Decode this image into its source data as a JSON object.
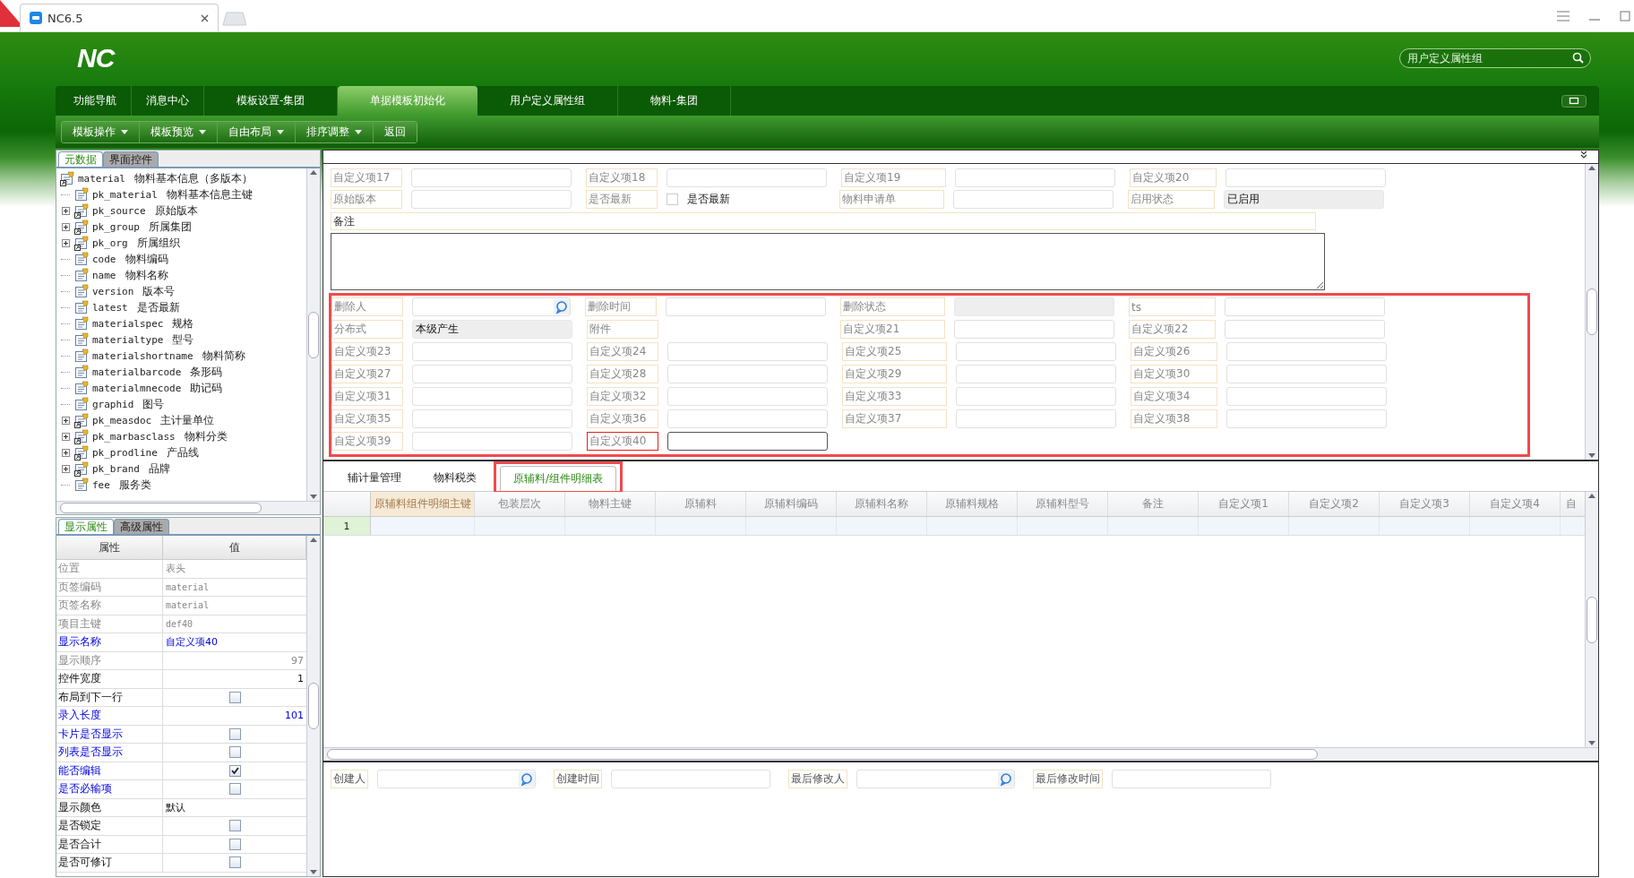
{
  "browser": {
    "tab_title": "NC6.5"
  },
  "header": {
    "logo": "NC",
    "search": {
      "placeholder": "用户定义属性组"
    }
  },
  "nav_tabs": [
    {
      "label": "功能导航",
      "selected": false
    },
    {
      "label": "消息中心",
      "selected": false
    },
    {
      "label": "模板设置-集团",
      "selected": false
    },
    {
      "label": "单据模板初始化",
      "selected": true
    },
    {
      "label": "用户定义属性组",
      "selected": false
    },
    {
      "label": "物料-集团",
      "selected": false
    }
  ],
  "toolbar": [
    {
      "label": "模板操作",
      "kind": "menu"
    },
    {
      "label": "模板预览",
      "kind": "menu"
    },
    {
      "label": "自由布局",
      "kind": "menu"
    },
    {
      "label": "排序调整",
      "kind": "menu"
    },
    {
      "label": "返回",
      "kind": "button"
    }
  ],
  "metadata_panel": {
    "tabs": [
      {
        "label": "元数据",
        "selected": true
      },
      {
        "label": "界面控件",
        "selected": false
      }
    ],
    "tree": {
      "code": "material",
      "label": "物料基本信息（多版本）",
      "children": [
        {
          "code": "pk_material",
          "label": "物料基本信息主键",
          "kind": "field"
        },
        {
          "code": "pk_source",
          "label": "原始版本",
          "kind": "ref"
        },
        {
          "code": "pk_group",
          "label": "所属集团",
          "kind": "ref"
        },
        {
          "code": "pk_org",
          "label": "所属组织",
          "kind": "ref"
        },
        {
          "code": "code",
          "label": "物料编码",
          "kind": "field"
        },
        {
          "code": "name",
          "label": "物料名称",
          "kind": "field"
        },
        {
          "code": "version",
          "label": "版本号",
          "kind": "field"
        },
        {
          "code": "latest",
          "label": "是否最新",
          "kind": "field"
        },
        {
          "code": "materialspec",
          "label": "规格",
          "kind": "field"
        },
        {
          "code": "materialtype",
          "label": "型号",
          "kind": "field"
        },
        {
          "code": "materialshortname",
          "label": "物料简称",
          "kind": "field"
        },
        {
          "code": "materialbarcode",
          "label": "条形码",
          "kind": "field"
        },
        {
          "code": "materialmnecode",
          "label": "助记码",
          "kind": "field"
        },
        {
          "code": "graphid",
          "label": "图号",
          "kind": "field"
        },
        {
          "code": "pk_measdoc",
          "label": "主计量单位",
          "kind": "ref"
        },
        {
          "code": "pk_marbasclass",
          "label": "物料分类",
          "kind": "ref"
        },
        {
          "code": "pk_prodline",
          "label": "产品线",
          "kind": "ref"
        },
        {
          "code": "pk_brand",
          "label": "品牌",
          "kind": "ref"
        },
        {
          "code": "fee",
          "label": "服务类",
          "kind": "field"
        }
      ]
    }
  },
  "properties_panel": {
    "tabs": [
      {
        "label": "显示属性",
        "selected": true
      },
      {
        "label": "高级属性",
        "selected": false
      }
    ],
    "columns": [
      "属性",
      "值"
    ],
    "rows": [
      {
        "name": "位置",
        "kind": "text",
        "value": "表头",
        "disabled": true,
        "highlighted": false
      },
      {
        "name": "页签编码",
        "kind": "code",
        "value": "material",
        "disabled": true,
        "highlighted": false
      },
      {
        "name": "页签名称",
        "kind": "code",
        "value": "material",
        "disabled": true,
        "highlighted": false
      },
      {
        "name": "项目主键",
        "kind": "code",
        "value": "def40",
        "disabled": true,
        "highlighted": false
      },
      {
        "name": "显示名称",
        "kind": "text",
        "value": "自定义项40",
        "disabled": false,
        "highlighted": true
      },
      {
        "name": "显示顺序",
        "kind": "number",
        "value": "97",
        "disabled": true,
        "highlighted": false
      },
      {
        "name": "控件宽度",
        "kind": "number",
        "value": "1",
        "disabled": false,
        "highlighted": false
      },
      {
        "name": "布局到下一行",
        "kind": "check",
        "checked": false,
        "disabled": false,
        "highlighted": false
      },
      {
        "name": "录入长度",
        "kind": "number",
        "value": "101",
        "disabled": false,
        "highlighted": true
      },
      {
        "name": "卡片是否显示",
        "kind": "check",
        "checked": false,
        "disabled": false,
        "highlighted": true
      },
      {
        "name": "列表是否显示",
        "kind": "check",
        "checked": false,
        "disabled": false,
        "highlighted": true
      },
      {
        "name": "能否编辑",
        "kind": "check",
        "checked": true,
        "disabled": false,
        "highlighted": true
      },
      {
        "name": "是否必输项",
        "kind": "check",
        "checked": false,
        "disabled": false,
        "highlighted": true
      },
      {
        "name": "显示颜色",
        "kind": "text",
        "value": "默认",
        "disabled": false,
        "highlighted": false
      },
      {
        "name": "是否锁定",
        "kind": "check",
        "checked": false,
        "disabled": false,
        "highlighted": false
      },
      {
        "name": "是否合计",
        "kind": "check",
        "checked": false,
        "disabled": false,
        "highlighted": false
      },
      {
        "name": "是否可修订",
        "kind": "check",
        "checked": false,
        "disabled": false,
        "highlighted": false
      }
    ]
  },
  "form": {
    "top_rows": [
      [
        {
          "label": "自定义项17",
          "kind": "text"
        },
        {
          "label": "自定义项18",
          "kind": "text"
        },
        {
          "label": "自定义项19",
          "kind": "text"
        },
        {
          "label": "自定义项20",
          "kind": "text"
        }
      ],
      [
        {
          "label": "原始版本",
          "kind": "text"
        },
        {
          "label": "是否最新",
          "kind": "check",
          "checked": false,
          "value": "是否最新"
        },
        {
          "label": "物料申请单",
          "kind": "text"
        },
        {
          "label": "启用状态",
          "kind": "readonly",
          "value": "已启用"
        }
      ]
    ],
    "remark": {
      "label": "备注"
    },
    "annotated_group": {
      "highlighted": true,
      "rows": [
        [
          {
            "label": "删除人",
            "kind": "ref",
            "highlighted": false
          },
          {
            "label": "删除时间",
            "kind": "text",
            "highlighted": false
          },
          {
            "label": "删除状态",
            "kind": "readonly",
            "highlighted": false
          },
          {
            "label": "ts",
            "kind": "text",
            "highlighted": false
          }
        ],
        [
          {
            "label": "分布式",
            "kind": "readonly",
            "value": "本级产生",
            "highlighted": false
          },
          {
            "label": "附件",
            "kind": "none",
            "highlighted": false
          },
          {
            "label": "自定义项21",
            "kind": "text",
            "highlighted": false
          },
          {
            "label": "自定义项22",
            "kind": "text",
            "highlighted": false
          }
        ],
        [
          {
            "label": "自定义项23",
            "kind": "text",
            "highlighted": false
          },
          {
            "label": "自定义项24",
            "kind": "text",
            "highlighted": false
          },
          {
            "label": "自定义项25",
            "kind": "text",
            "highlighted": false
          },
          {
            "label": "自定义项26",
            "kind": "text",
            "highlighted": false
          }
        ],
        [
          {
            "label": "自定义项27",
            "kind": "text",
            "highlighted": false
          },
          {
            "label": "自定义项28",
            "kind": "text",
            "highlighted": false
          },
          {
            "label": "自定义项29",
            "kind": "text",
            "highlighted": false
          },
          {
            "label": "自定义项30",
            "kind": "text",
            "highlighted": false
          }
        ],
        [
          {
            "label": "自定义项31",
            "kind": "text",
            "highlighted": false
          },
          {
            "label": "自定义项32",
            "kind": "text",
            "highlighted": false
          },
          {
            "label": "自定义项33",
            "kind": "text",
            "highlighted": false
          },
          {
            "label": "自定义项34",
            "kind": "text",
            "highlighted": false
          }
        ],
        [
          {
            "label": "自定义项35",
            "kind": "text",
            "highlighted": false
          },
          {
            "label": "自定义项36",
            "kind": "text",
            "highlighted": false
          },
          {
            "label": "自定义项37",
            "kind": "text",
            "highlighted": false
          },
          {
            "label": "自定义项38",
            "kind": "text",
            "highlighted": false
          }
        ],
        [
          {
            "label": "自定义项39",
            "kind": "text",
            "highlighted": false
          },
          {
            "label": "自定义项40",
            "kind": "focused",
            "highlighted": true
          }
        ]
      ]
    }
  },
  "sub_tabs": [
    {
      "label": "辅计量管理",
      "selected": false,
      "highlighted": false
    },
    {
      "label": "物料税类",
      "selected": false,
      "highlighted": false
    },
    {
      "label": "原辅料/组件明细表",
      "selected": true,
      "highlighted": true
    }
  ],
  "grid": {
    "columns": [
      {
        "label": "原辅料组件明细主键",
        "selected": true
      },
      {
        "label": "包装层次",
        "selected": false
      },
      {
        "label": "物料主键",
        "selected": false
      },
      {
        "label": "原辅料",
        "selected": false
      },
      {
        "label": "原辅料编码",
        "selected": false
      },
      {
        "label": "原辅料名称",
        "selected": false
      },
      {
        "label": "原辅料规格",
        "selected": false
      },
      {
        "label": "原辅料型号",
        "selected": false
      },
      {
        "label": "备注",
        "selected": false
      },
      {
        "label": "自定义项1",
        "selected": false
      },
      {
        "label": "自定义项2",
        "selected": false
      },
      {
        "label": "自定义项3",
        "selected": false
      },
      {
        "label": "自定义项4",
        "selected": false
      },
      {
        "label": "自",
        "selected": false
      }
    ],
    "rows": [
      {
        "row_number": "1"
      }
    ]
  },
  "footer": [
    {
      "label": "创建人",
      "kind": "ref"
    },
    {
      "label": "创建时间",
      "kind": "text"
    },
    {
      "label": "最后修改人",
      "kind": "ref"
    },
    {
      "label": "最后修改时间",
      "kind": "text"
    }
  ]
}
